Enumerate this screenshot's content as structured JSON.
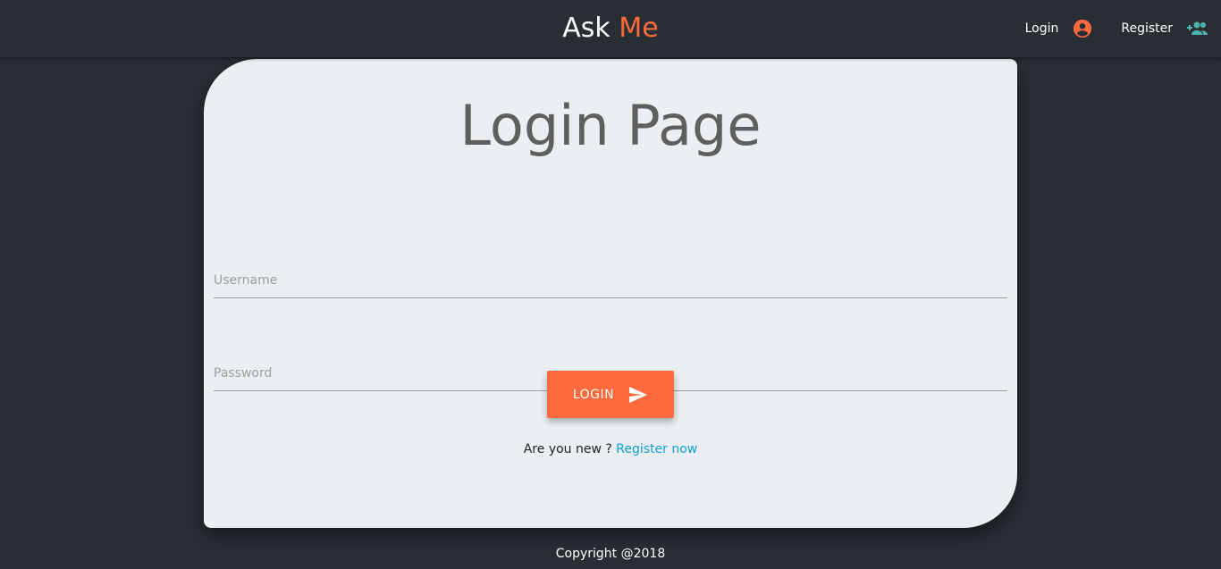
{
  "navbar": {
    "brand_main": "Ask",
    "brand_accent": "Me",
    "login_label": "Login",
    "login_icon": "account-circle-icon",
    "register_label": "Register",
    "register_icon": "group-add-icon"
  },
  "card": {
    "title": "Login Page",
    "username_placeholder": "Username",
    "password_placeholder": "Password",
    "login_button_label": "LOGIN",
    "login_button_icon": "send-icon",
    "register_prompt": "Are you new ?",
    "register_link": "Register now"
  },
  "footer": {
    "copyright": "Copyright @2018"
  },
  "colors": {
    "background": "#292e35",
    "card": "#eceff1",
    "accent": "#ff6a3d",
    "register_icon": "#4db6ac",
    "link": "#0a9fd6"
  }
}
